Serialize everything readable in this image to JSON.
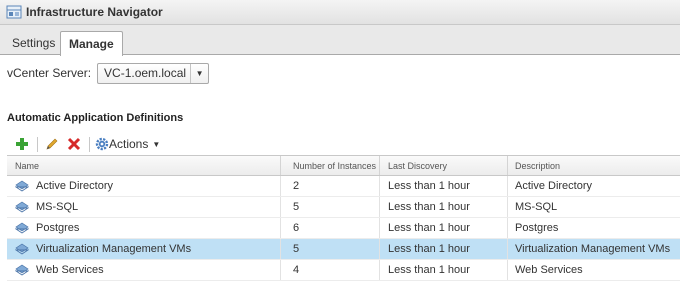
{
  "window": {
    "title": "Infrastructure Navigator"
  },
  "tabs": [
    {
      "label": "Settings",
      "active": false
    },
    {
      "label": "Manage",
      "active": true
    }
  ],
  "vcenter": {
    "label": "vCenter Server:",
    "value": "VC-1.oem.local"
  },
  "section": {
    "title": "Automatic Application Definitions"
  },
  "toolbar": {
    "add_icon": "plus-icon",
    "edit_icon": "pencil-icon",
    "delete_icon": "delete-x-icon",
    "actions_icon": "gear-icon",
    "actions_label": "Actions"
  },
  "grid": {
    "columns": [
      "Name",
      "Number of Instances",
      "Last Discovery",
      "Description"
    ],
    "rows": [
      {
        "name": "Active Directory",
        "instances": "2",
        "last_discovery": "Less than 1 hour",
        "description": "Active Directory",
        "selected": false
      },
      {
        "name": "MS-SQL",
        "instances": "5",
        "last_discovery": "Less than 1 hour",
        "description": "MS-SQL",
        "selected": false
      },
      {
        "name": "Postgres",
        "instances": "6",
        "last_discovery": "Less than 1 hour",
        "description": "Postgres",
        "selected": false
      },
      {
        "name": "Virtualization Management VMs",
        "instances": "5",
        "last_discovery": "Less than 1 hour",
        "description": "Virtualization Management VMs",
        "selected": true
      },
      {
        "name": "Web Services",
        "instances": "4",
        "last_discovery": "Less than 1 hour",
        "description": "Web Services",
        "selected": false
      }
    ]
  },
  "colors": {
    "selected_row": "#bfe0f5",
    "add_green": "#3aa335",
    "delete_red": "#d62a2a",
    "edit_pencil": "#e0a82e",
    "gear_blue": "#4a7fc1"
  }
}
